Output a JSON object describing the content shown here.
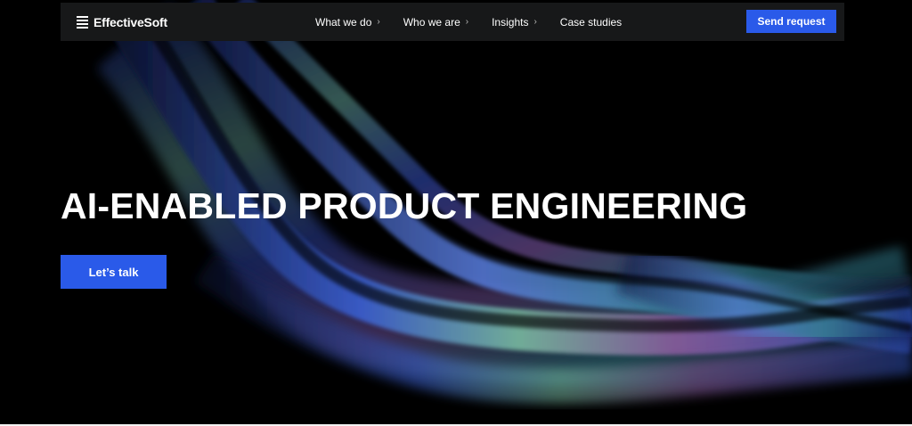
{
  "brand": {
    "name": "EffectiveSoft",
    "logo_icon": "stacked-lines-icon"
  },
  "nav": {
    "items": [
      {
        "label": "What we do",
        "has_dropdown": true
      },
      {
        "label": "Who we are",
        "has_dropdown": true
      },
      {
        "label": "Insights",
        "has_dropdown": true
      },
      {
        "label": "Case studies",
        "has_dropdown": false
      }
    ],
    "chevron": "›",
    "cta_label": "Send request"
  },
  "hero": {
    "headline": "AI-ENABLED PRODUCT ENGINEERING",
    "cta_label": "Let’s talk"
  },
  "colors": {
    "accent": "#2a5ae9",
    "navbar_bg": "#171819",
    "page_bg": "#000000"
  }
}
